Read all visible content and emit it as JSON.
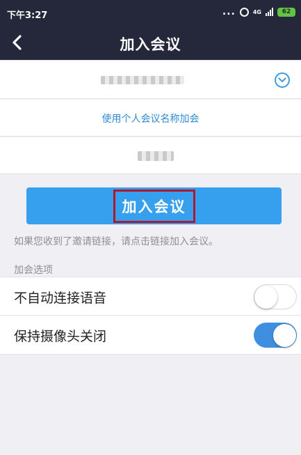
{
  "status_bar": {
    "time": "下午3:27",
    "dots": "...",
    "network": "4G",
    "battery": "62"
  },
  "nav": {
    "title": "加入会议"
  },
  "form": {
    "join_by_name_link": "使用个人会议名称加会",
    "join_button": "加入会议",
    "hint": "如果您收到了邀请链接，请点击链接加入会议。",
    "options_title": "加会选项"
  },
  "options": [
    {
      "label": "不自动连接语音",
      "enabled": false
    },
    {
      "label": "保持摄像头关闭",
      "enabled": true
    }
  ],
  "colors": {
    "nav_background": "#24283a",
    "accent": "#36a0ef",
    "link": "#2f8ad6",
    "highlight_border": "#b1182b",
    "battery": "#63c43f"
  }
}
